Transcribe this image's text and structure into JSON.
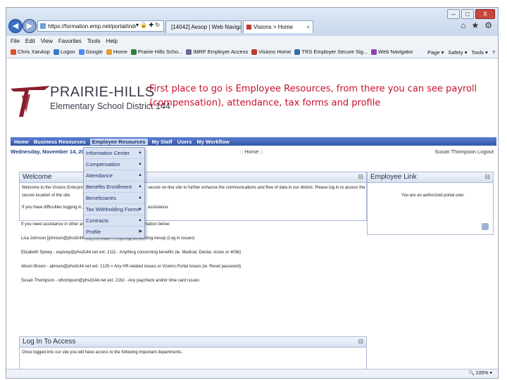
{
  "browser": {
    "window_buttons": [
      "–",
      "□",
      "X"
    ],
    "address": "https://formation.emp.net/portal/index244n",
    "address_icons": "▾ 🔒 ✚ ↻",
    "tabs": [
      {
        "label": "[14042] Aesop | Web Navigator",
        "active": false
      },
      {
        "label": "Visions > Home",
        "active": true
      }
    ],
    "tab_close": "×",
    "toolbar_icons": [
      "⌂",
      "★",
      "⚙"
    ],
    "back_glyph": "◀",
    "forward_glyph": "▶"
  },
  "menubar": [
    "File",
    "Edit",
    "View",
    "Favorites",
    "Tools",
    "Help"
  ],
  "favorites": [
    {
      "label": "Chris XanAsp",
      "color": "#d9542b"
    },
    {
      "label": "Logon",
      "color": "#3b78c4"
    },
    {
      "label": "Google",
      "color": "#4c8bf5"
    },
    {
      "label": "Home",
      "color": "#e2a233"
    },
    {
      "label": "Prairie Hills Scho...",
      "color": "#2f7d3d"
    },
    {
      "label": "IMRF Employer Access",
      "color": "#6b6b8f"
    },
    {
      "label": "Visions Home",
      "color": "#c0392b"
    },
    {
      "label": "TRS Employer Secure Sig...",
      "color": "#2e6da4"
    },
    {
      "label": "Web Navigator",
      "color": "#8e44ad"
    }
  ],
  "command_bar": [
    "Page ▾",
    "Safety ▾",
    "Tools ▾",
    "?"
  ],
  "logo": {
    "line1": "PRAIRIE-HILLS",
    "line2": "Elementary School District 144"
  },
  "callout": "First place to go is Employee Resources, from there you can see payroll (compensation), attendance, tax forms and profile",
  "nav": [
    "Home",
    "Business Resources",
    "Employee Resources",
    "My Staff",
    "Users",
    "My Workflow"
  ],
  "dateline": {
    "date": "Wednesday, November 14, 2012",
    "home": ":: Home ::",
    "user": "Susan Thompson  Logout"
  },
  "dropdown": [
    {
      "label": "Information Center",
      "arrow": "▲"
    },
    {
      "label": "Compensation",
      "arrow": "▲"
    },
    {
      "label": "Attendance",
      "arrow": "▲"
    },
    {
      "label": "Benefits Enrollment",
      "arrow": "▲"
    },
    {
      "label": "Beneficiaries",
      "arrow": "▲"
    },
    {
      "label": "Tax Withholding Forms",
      "arrow": "▲"
    },
    {
      "label": "Contracts",
      "arrow": "▲"
    },
    {
      "label": "Profile",
      "arrow": "▶"
    }
  ],
  "welcome_panel": {
    "title": "Welcome",
    "btn": "⊟",
    "line1a": "Welcome to the Visions Enterpris",
    "line1b": "secure on-line site to further enhance the communications and flow of data in our district. Please log in to access the",
    "line2": "secure location of the site.",
    "line3a": "If you have difficulties logging in,",
    "line3b": "assistance."
  },
  "link_panel": {
    "title": "Employee Link",
    "btn": "⊟",
    "text": "You are an authorized portal user."
  },
  "contacts": [
    "If you need assistance in other areas, please see the contact information below:",
    "Lisa Johnson  [johnson@phsd144.net] ext. 2115 = Anything concerning Aesop (Log in issues)",
    "Elizabeth Spivey - espivey@phsd144.net ext. 2111 - Anything concerning benefits (ie. Medical, Dental, vision or 403b)",
    "Alison Brown - abrown@phsd144.net ext. 2125 = Any HR-related issues or Visions Portal issues (ie. Reset password)",
    "Susan Thompson - sthompson@phsd144.net ext. 2162 - Any paycheck and/or time card issues"
  ],
  "login_panel": {
    "title": "Log In To Access",
    "btn": "⊟",
    "text": "Once logged into our site you will have access to the following important departments."
  },
  "status": {
    "zoom": "🔍 100% ▾"
  }
}
